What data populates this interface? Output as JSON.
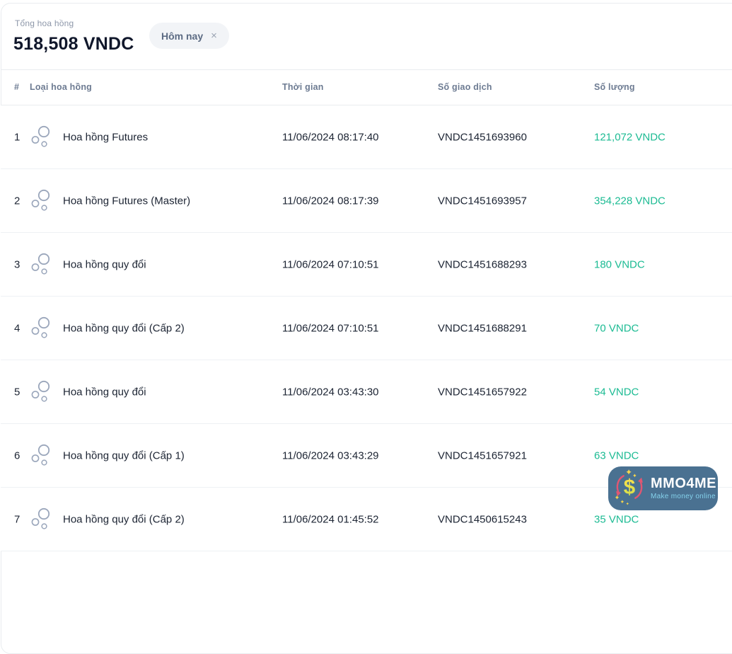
{
  "summary": {
    "label": "Tổng hoa hồng",
    "total": "518,508 VNDC",
    "chip": {
      "label": "Hôm nay",
      "close": "×"
    }
  },
  "table": {
    "headers": {
      "index": "#",
      "type": "Loại hoa hồng",
      "time": "Thời gian",
      "tx": "Số giao dịch",
      "amount": "Số lượng"
    },
    "rows": [
      {
        "index": "1",
        "type": "Hoa hồng Futures",
        "time": "11/06/2024 08:17:40",
        "tx": "VNDC1451693960",
        "amount": "121,072 VNDC"
      },
      {
        "index": "2",
        "type": "Hoa hồng Futures (Master)",
        "time": "11/06/2024 08:17:39",
        "tx": "VNDC1451693957",
        "amount": "354,228 VNDC"
      },
      {
        "index": "3",
        "type": "Hoa hồng quy đổi",
        "time": "11/06/2024 07:10:51",
        "tx": "VNDC1451688293",
        "amount": "180 VNDC"
      },
      {
        "index": "4",
        "type": "Hoa hồng quy đổi (Cấp 2)",
        "time": "11/06/2024 07:10:51",
        "tx": "VNDC1451688291",
        "amount": "70 VNDC"
      },
      {
        "index": "5",
        "type": "Hoa hồng quy đổi",
        "time": "11/06/2024 03:43:30",
        "tx": "VNDC1451657922",
        "amount": "54 VNDC"
      },
      {
        "index": "6",
        "type": "Hoa hồng quy đổi (Cấp 1)",
        "time": "11/06/2024 03:43:29",
        "tx": "VNDC1451657921",
        "amount": "63 VNDC"
      },
      {
        "index": "7",
        "type": "Hoa hồng quy đổi (Cấp 2)",
        "time": "11/06/2024 01:45:52",
        "tx": "VNDC1450615243",
        "amount": "35 VNDC"
      }
    ]
  },
  "watermark": {
    "name": "MMO4ME",
    "tagline": "Make money online",
    "dollar_glyph": "$"
  },
  "colors": {
    "amount_teal": "#1cbb93",
    "header_slate": "#6d7b92",
    "dark_text": "#1c2433",
    "chip_bg": "#f2f4f7",
    "logo_bg": "#4a7191",
    "logo_pink": "#e25672",
    "logo_yellow": "#f7d64b"
  }
}
